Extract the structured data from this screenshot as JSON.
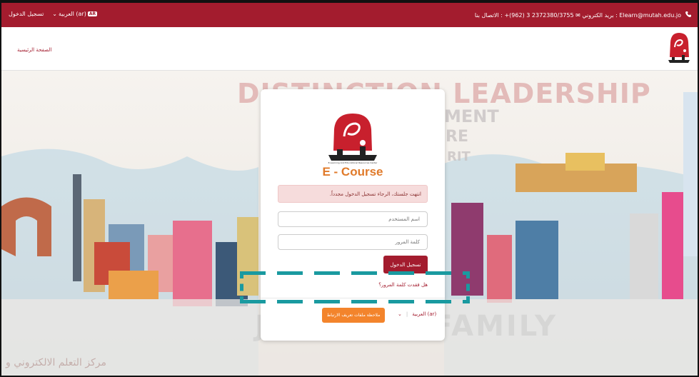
{
  "topbar": {
    "login_label": "تسجيل الدخول",
    "language_label": "العربية (ar)",
    "language_badge": "AR",
    "contact_text": "Elearn@mutah.edu.jo : بريد الكتروني ✉ 2372380/3755 3 (962)+ : الاتصال بنا",
    "phone_icon": "phone-icon"
  },
  "navbar": {
    "home_label": "الصفحة الرئيسية"
  },
  "login": {
    "brand_title": "E - Course",
    "brand_subtitle": "E-Learning And Educational Resources Center",
    "alert_text": "انتهت جلستك، الرجاء تسجيل الدخول مجدداً.",
    "username_placeholder": "اسم المستخدم",
    "password_placeholder": "كلمة المرور",
    "login_button": "تسجيل الدخول",
    "forgot_link": "هل فقدت كلمة المرور؟",
    "language_select": "العربية (ar)",
    "cookie_button": "ملاحظة ملفات تعريف الارتباط"
  },
  "background": {
    "slogan_top": "DISTINCTION LEADERSHIP",
    "slogan_words": [
      "MENT",
      "RE",
      "RIT"
    ],
    "slogan_bottom": "JOIN OUR FAMILY",
    "corner_text": "مركز التعلم الالكتروني و"
  },
  "colors": {
    "brand": "#a31c2e",
    "accent": "#f3842c",
    "annotation": "#1a9aa0"
  }
}
